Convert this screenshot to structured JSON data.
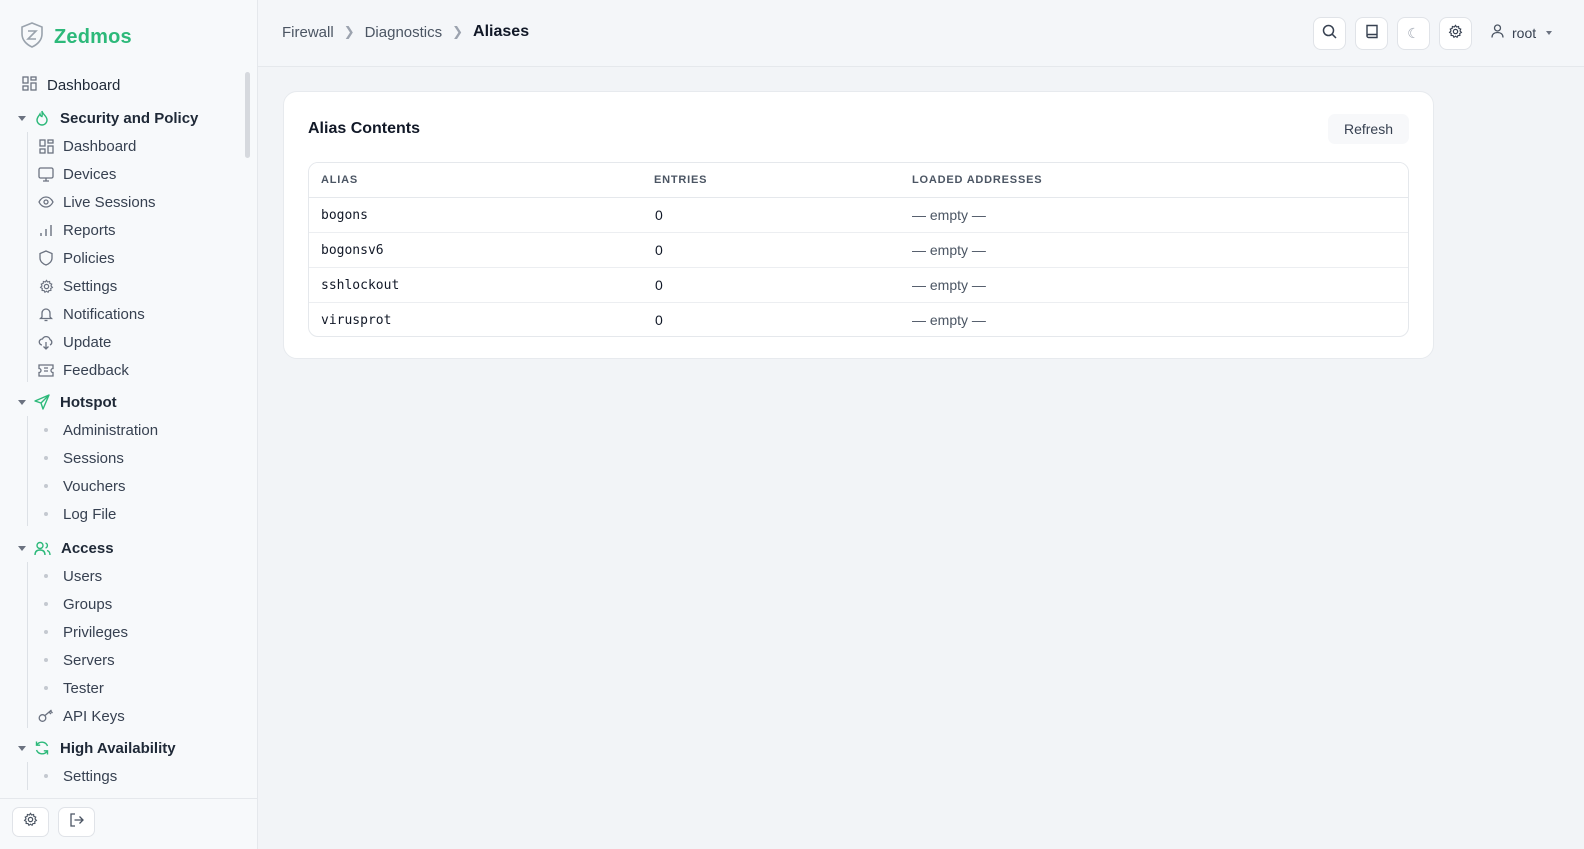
{
  "brand": {
    "name": "Zedmos",
    "accent": "#2db97a"
  },
  "sidebar": {
    "top_item": {
      "label": "Dashboard",
      "icon": "grid-icon"
    },
    "sections": [
      {
        "title": "Security and Policy",
        "icon": "flame-icon",
        "items": [
          {
            "label": "Dashboard",
            "icon": "grid-icon"
          },
          {
            "label": "Devices",
            "icon": "monitor-icon"
          },
          {
            "label": "Live Sessions",
            "icon": "eye-icon"
          },
          {
            "label": "Reports",
            "icon": "bar-chart-icon"
          },
          {
            "label": "Policies",
            "icon": "shield-icon"
          },
          {
            "label": "Settings",
            "icon": "gear-icon"
          },
          {
            "label": "Notifications",
            "icon": "bell-icon"
          },
          {
            "label": "Update",
            "icon": "cloud-download-icon"
          },
          {
            "label": "Feedback",
            "icon": "ticket-icon"
          }
        ]
      },
      {
        "title": "Hotspot",
        "icon": "send-icon",
        "items": [
          {
            "label": "Administration"
          },
          {
            "label": "Sessions"
          },
          {
            "label": "Vouchers"
          },
          {
            "label": "Log File"
          }
        ]
      },
      {
        "title": "Access",
        "icon": "users-icon",
        "items": [
          {
            "label": "Users"
          },
          {
            "label": "Groups"
          },
          {
            "label": "Privileges"
          },
          {
            "label": "Servers"
          },
          {
            "label": "Tester"
          },
          {
            "label": "API Keys",
            "icon": "key-icon"
          }
        ]
      },
      {
        "title": "High Availability",
        "icon": "refresh-icon",
        "items": [
          {
            "label": "Settings"
          }
        ]
      }
    ]
  },
  "header": {
    "breadcrumb": [
      "Firewall",
      "Diagnostics",
      "Aliases"
    ],
    "user": "root"
  },
  "card": {
    "title": "Alias Contents",
    "refresh_label": "Refresh",
    "columns": [
      "ALIAS",
      "ENTRIES",
      "LOADED ADDRESSES"
    ],
    "rows": [
      {
        "alias": "bogons",
        "entries": "0",
        "addresses": "— empty —"
      },
      {
        "alias": "bogonsv6",
        "entries": "0",
        "addresses": "— empty —"
      },
      {
        "alias": "sshlockout",
        "entries": "0",
        "addresses": "— empty —"
      },
      {
        "alias": "virusprot",
        "entries": "0",
        "addresses": "— empty —"
      }
    ]
  }
}
